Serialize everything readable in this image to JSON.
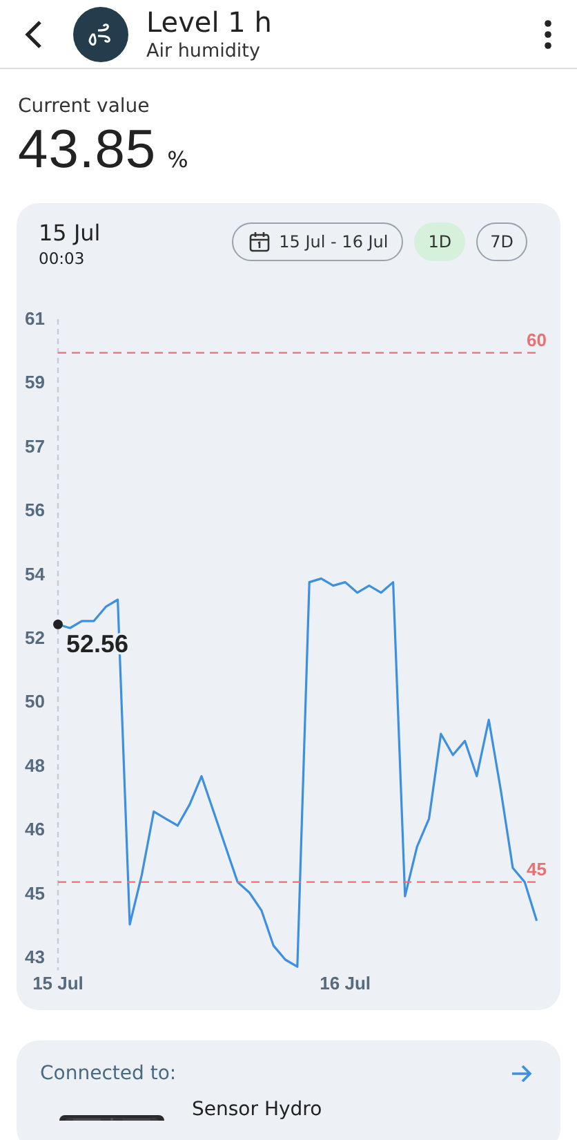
{
  "header": {
    "title": "Level 1 h",
    "subtitle": "Air humidity"
  },
  "current": {
    "label": "Current value",
    "value": "43.85",
    "unit": "%"
  },
  "chart_card": {
    "date": "15 Jul",
    "time": "00:03",
    "range": "15 Jul - 16 Jul",
    "periods": [
      {
        "label": "1D",
        "selected": true
      },
      {
        "label": "7D",
        "selected": false
      }
    ],
    "tooltip": {
      "value": "52.56"
    },
    "chart_data": {
      "type": "line",
      "categories": [
        "15 Jul",
        null,
        null,
        null,
        null,
        null,
        null,
        null,
        null,
        null,
        null,
        null,
        null,
        null,
        null,
        null,
        null,
        null,
        null,
        null,
        null,
        null,
        null,
        null,
        "16 Jul",
        null,
        null,
        null,
        null,
        null,
        null,
        null,
        null,
        null,
        null,
        null,
        null,
        null,
        null,
        null,
        null
      ],
      "series": [
        {
          "color": "#3d8fe0",
          "values": [
            52.3,
            52.2,
            52.4,
            52.4,
            52.8,
            53.0,
            43.8,
            45.2,
            47.0,
            46.8,
            46.6,
            47.2,
            48.0,
            47.0,
            46.0,
            45.0,
            44.7,
            44.2,
            43.2,
            42.8,
            42.6,
            53.5,
            53.6,
            53.4,
            53.5,
            53.2,
            53.4,
            53.2,
            53.5,
            44.6,
            46.0,
            46.8,
            49.2,
            48.6,
            49.0,
            48.0,
            49.6,
            47.6,
            45.4,
            45.0,
            43.9
          ]
        },
        {
          "name": "60",
          "color": "#e57373",
          "line_style": "dashed",
          "values": [
            60,
            60,
            60,
            60,
            60,
            60,
            60,
            60,
            60,
            60,
            60,
            60,
            60,
            60,
            60,
            60,
            60,
            60,
            60,
            60,
            60,
            60,
            60,
            60,
            60,
            60,
            60,
            60,
            60,
            60,
            60,
            60,
            60,
            60,
            60,
            60,
            60,
            60,
            60,
            60,
            60
          ]
        },
        {
          "name": "45",
          "color": "#e57373",
          "line_style": "dashed",
          "values": [
            45,
            45,
            45,
            45,
            45,
            45,
            45,
            45,
            45,
            45,
            45,
            45,
            45,
            45,
            45,
            45,
            45,
            45,
            45,
            45,
            45,
            45,
            45,
            45,
            45,
            45,
            45,
            45,
            45,
            45,
            45,
            45,
            45,
            45,
            45,
            45,
            45,
            45,
            45,
            45,
            45
          ]
        }
      ],
      "ylim": [
        42.5,
        60.95
      ],
      "yticks": [
        {
          "value": 60.95,
          "label": "61"
        },
        {
          "value": 59.14,
          "label": "59"
        },
        {
          "value": 57.33,
          "label": "57"
        },
        {
          "value": 55.52,
          "label": "56"
        },
        {
          "value": 53.71,
          "label": "54"
        },
        {
          "value": 51.91,
          "label": "52"
        },
        {
          "value": 50.1,
          "label": "50"
        },
        {
          "value": 48.29,
          "label": "48"
        },
        {
          "value": 46.48,
          "label": "46"
        },
        {
          "value": 44.67,
          "label": "45"
        },
        {
          "value": 42.86,
          "label": "43"
        }
      ]
    }
  },
  "connected": {
    "label": "Connected to:",
    "device": "Sensor Hydro"
  }
}
